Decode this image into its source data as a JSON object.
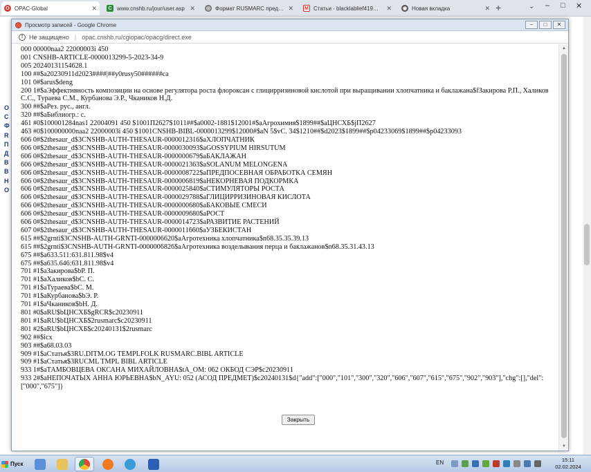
{
  "browser": {
    "tabs": [
      {
        "title": "OPAC-Global",
        "icon": "opac-icon",
        "color": "#d63a2f"
      },
      {
        "title": "www.cnshb.ru/jour/user.asp",
        "icon": "cnshb-icon",
        "color": "#2e8b3d"
      },
      {
        "title": "Формат RUSMARC представ...",
        "icon": "globe-icon",
        "color": "#666666"
      },
      {
        "title": "Статьи - blacklablief419@g...",
        "icon": "gmail-icon",
        "color": "#d93025"
      },
      {
        "title": "Новая вкладка",
        "icon": "chrome-icon",
        "color": "#555555"
      }
    ],
    "new_tab": "+",
    "window_controls": {
      "minimize": "–",
      "maximize": "□",
      "close": "✕"
    }
  },
  "background_page": {
    "letters": [
      "О",
      "С",
      "",
      "Ф",
      "R",
      "П",
      "",
      "Д",
      "",
      "В",
      "В",
      "Н",
      "О"
    ]
  },
  "popup": {
    "title": "Просмотр записей - Google Chrome",
    "security_label": "Не защищено",
    "url": "opac.cnshb.ru/cgiopac/opacg/direct.exe",
    "close_button": "Закрыть",
    "record_lines": [
      "000 00000naa2 22000003i 450",
      "001 CNSHB-ARTICLE-0000013299-5-2023-34-9",
      "005 20240131154628.1",
      "100 ##$a20230911d2023####|##y0rusy50######ca",
      "101 0#$arus$deng",
      "200 1#$aЭффективность композиции на основе регулятора роста флороксан с глицирризиновой кислотой при выращивании хлопчатника и баклажана$fЗакирова Р.П., Халиков С.С., Тураева С.М., Курбанова Э.Р., Чкаников Н.Д.",
      "300 ##$aРез. рус., англ.",
      "320 ##$aБиблиогр.: с.",
      "461 #0$100001284nas1 22004091 450 $1001П2627$1011##$a0002-1881$12001#$aАгрохимия$1899##$aЦНСХБ$jП2627",
      "463 #0$100000000naa2 22000003i 450 $1001CNSHB-BIBL-0000013299$12000#$aN 5$vC. 34$1210##$d2023$1899##$p04233069$1899##$p04233093",
      "606 0#$2thesaur_d$3CNSHB-AUTH-THESAUR-0000012316$aХЛОПЧАТНИК",
      "606 0#$2thesaur_d$3CNSHB-AUTH-THESAUR-0000030093$aGOSSYPIUM HIRSUTUM",
      "606 0#$2thesaur_d$3CNSHB-AUTH-THESAUR-0000000679$aБАКЛАЖАН",
      "606 0#$2thesaur_d$3CNSHB-AUTH-THESAUR-0000021363$aSOLANUM MELONGENA",
      "606 0#$2thesaur_d$3CNSHB-AUTH-THESAUR-0000008722$aПРЕДПОСЕВНАЯ ОБРАБОТКА СЕМЯН",
      "606 0#$2thesaur_d$3CNSHB-AUTH-THESAUR-0000006819$aНЕКОРНЕВАЯ ПОДКОРМКА",
      "606 0#$2thesaur_d$3CNSHB-AUTH-THESAUR-0000025840$aСТИМУЛЯТОРЫ РОСТА",
      "606 0#$2thesaur_d$3CNSHB-AUTH-THESAUR-0000029788$aГЛИЦИРРИЗИНОВАЯ КИСЛОТА",
      "606 0#$2thesaur_d$3CNSHB-AUTH-THESAUR-0000000680$aБАКОВЫЕ СМЕСИ",
      "606 0#$2thesaur_d$3CNSHB-AUTH-THESAUR-0000009680$aРОСТ",
      "606 0#$2thesaur_d$3CNSHB-AUTH-THESAUR-0000014723$aРАЗВИТИЕ РАСТЕНИЙ",
      "607 0#$2thesaur_d$3CNSHB-AUTH-THESAUR-0000011660$aУЗБЕКИСТАН",
      "615 ##$2grnti$3CNSHB-AUTH-GRNTI-0000006620$aАгротехника хлопчатника$n68.35.35.39.13",
      "615 ##$2grnti$3CNSHB-AUTH-GRNTI-0000006826$aАгротехника возделывания перца и баклажанов$n68.35.31.43.13",
      "675 ##$a633.511:631.811.98$v4",
      "675 ##$a635.646:631.811.98$v4",
      "701 #1$aЗакирова$bР. П.",
      "701 #1$aХаликов$bС. С.",
      "701 #1$aТураева$bС. М.",
      "701 #1$aКурбанова$bЭ. Р.",
      "701 #1$aЧкаников$bН. Д.",
      "801 #0$aRU$bЦНСХБ$gRCR$c20230911",
      "801 #1$aRU$bЦНСХБ$2rusmarc$c20230911",
      "801 #2$aRU$bЦНСХБ$c20240131$2rusmarc",
      "902 ##$icx",
      "903 ##$a68.03.03",
      "909 #1$aСтатья$3RU.DITM.OG TEMPLFOLK RUSMARC.BIBL ARTICLE",
      "909 #1$aСтатья$3RUCML TMPL BIBL ARTICLE",
      "933 1#$aТАМБОВЦЕВА ОКСАНА МИХАЙЛОВНА$tA_OM: 062 ОКБОД СЭР$c20230911",
      "933 2#$aНЕПОЧАТЫХ АННА ЮРЬЕВНА$bN_AYU: 052 (АСОД ПРЕДМЕТ)$c20240131$d{\"add\":[\"000\",\"101\",\"300\",\"320\",\"606\",\"607\",\"615\",\"675\",\"902\",\"903\"],\"chg\":[],\"del\":[\"000\",\"675\"]}"
    ]
  },
  "taskbar": {
    "start_label": "Пуск",
    "language": "EN",
    "time": "15:11",
    "date": "02.02.2024",
    "apps": [
      {
        "name": "explorer-icon",
        "color": "#5a8fd6"
      },
      {
        "name": "folder-icon",
        "color": "#e8c35a"
      },
      {
        "name": "chrome-icon",
        "color": "#e0463a"
      },
      {
        "name": "firefox-icon",
        "color": "#f07a1f"
      },
      {
        "name": "control-panel-icon",
        "color": "#3a9bd9"
      },
      {
        "name": "word-icon",
        "color": "#2b5fb3"
      }
    ]
  }
}
